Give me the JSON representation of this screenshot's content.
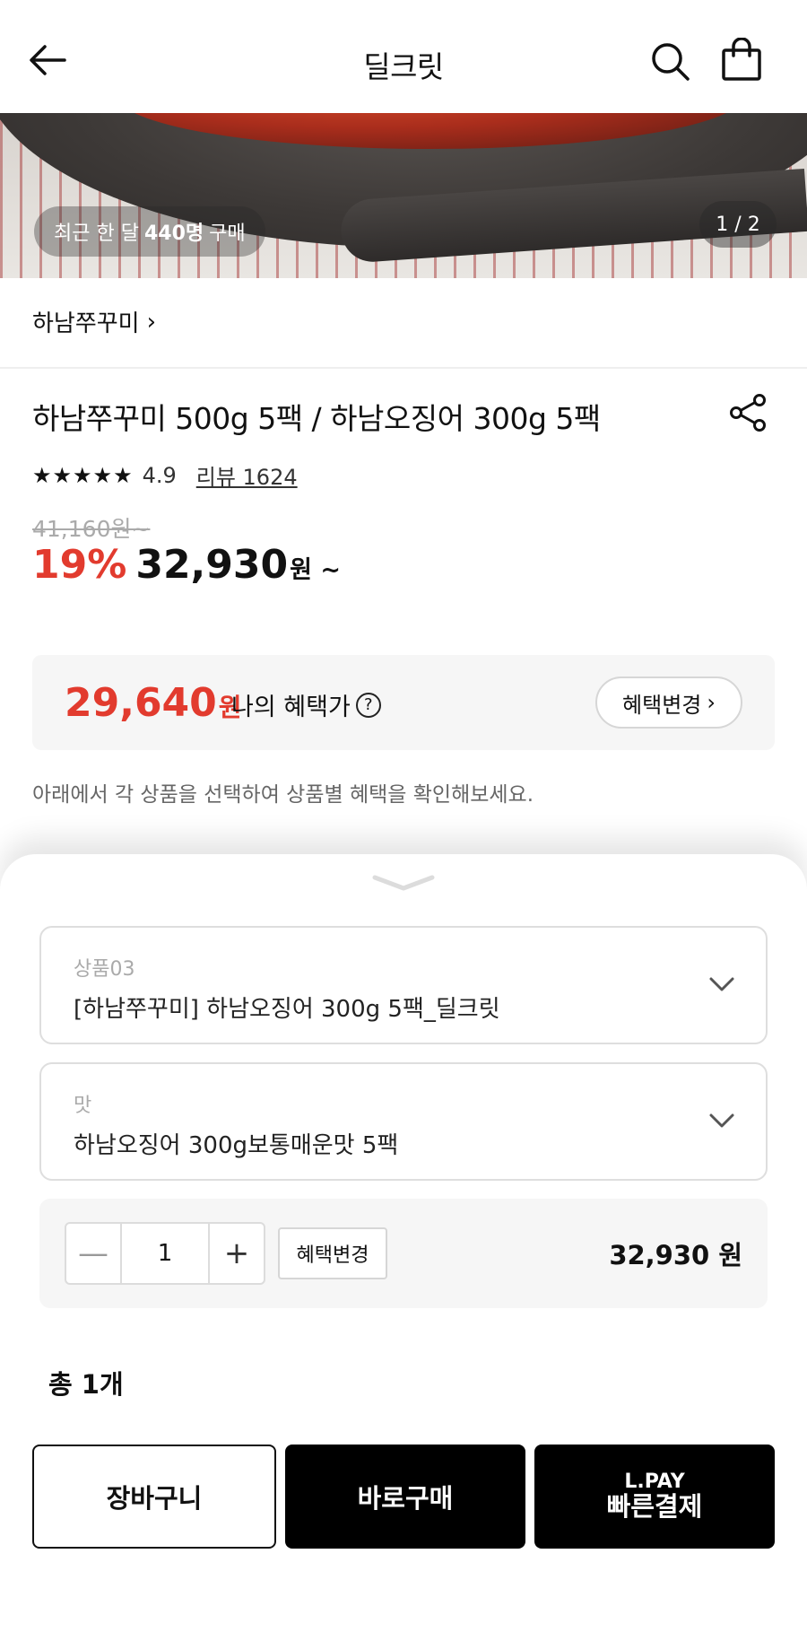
{
  "header": {
    "title": "딜크릿"
  },
  "hero": {
    "badge_prefix": "최근 한 달",
    "badge_count": "440명",
    "badge_suffix": "구매",
    "pager": "1 / 2"
  },
  "brand": {
    "name": "하남쭈꾸미",
    "chevron": "›"
  },
  "product": {
    "title": "하남쭈꾸미 500g 5팩 / 하남오징어 300g 5팩",
    "stars": "★★★★★",
    "rating": "4.9",
    "review": "리뷰 1624",
    "original_price": "41,160원~",
    "discount": "19%",
    "price": "32,930",
    "price_unit": "원 ~"
  },
  "benefit": {
    "price": "29,640",
    "unit": "원",
    "label": "나의 혜택가",
    "help": "?",
    "change_label": "혜택변경",
    "change_chevron": "›"
  },
  "notice": "아래에서 각 상품을 선택하여 상품별 혜택을 확인해보세요.",
  "sheet": {
    "option1": {
      "label": "상품03",
      "value": "[하남쭈꾸미] 하남오징어 300g 5팩_딜크릿"
    },
    "option2": {
      "label": "맛",
      "value": "하남오징어 300g보통매운맛 5팩"
    },
    "quantity": {
      "minus": "—",
      "value": "1",
      "plus": "+",
      "benefit_change": "혜택변경",
      "subtotal": "32,930 원"
    },
    "total": "총 1개",
    "actions": {
      "cart": "장바구니",
      "buy_now": "바로구매",
      "lpay_line1": "L.PAY",
      "lpay_line2": "빠른결제"
    }
  },
  "colors": {
    "accent_red": "#e23b2e",
    "black": "#000000",
    "panel_gray": "#f6f6f6"
  }
}
